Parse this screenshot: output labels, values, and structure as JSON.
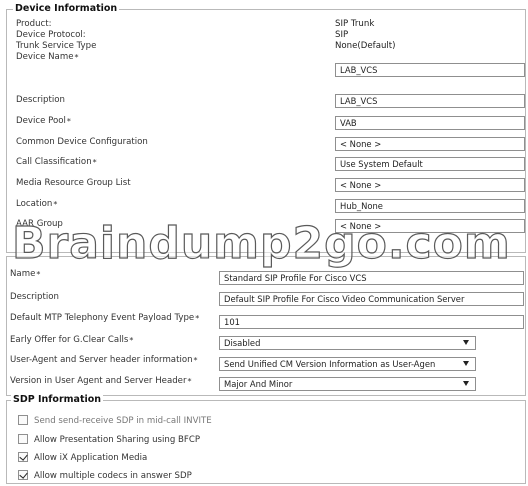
{
  "device_info": {
    "legend": "Device Information",
    "product_label": "Product:",
    "product_value": "SIP Trunk",
    "protocol_label": "Device Protocol:",
    "protocol_value": "SIP",
    "trunk_type_label": "Trunk Service Type",
    "trunk_type_value": "None(Default)",
    "device_name_label": "Device Name",
    "device_name_value": "LAB_VCS",
    "description_label": "Description",
    "description_value": "LAB_VCS",
    "device_pool_label": "Device Pool",
    "device_pool_value": "VAB",
    "common_config_label": "Common Device Configuration",
    "common_config_value": "< None >",
    "call_class_label": "Call Classification",
    "call_class_value": "Use System Default",
    "mrgl_label": "Media Resource Group List",
    "mrgl_value": "< None >",
    "location_label": "Location",
    "location_value": "Hub_None",
    "aar_label": "AAR Group",
    "aar_value": "< None >"
  },
  "sip_profile": {
    "name_label": "Name",
    "name_value": "Standard SIP Profile For Cisco VCS",
    "description_label": "Description",
    "description_value": "Default SIP Profile For Cisco Video Communication Server",
    "mtp_label": "Default MTP Telephony Event Payload Type",
    "mtp_value": "101",
    "early_offer_label": "Early Offer for G.Clear Calls",
    "early_offer_value": "Disabled",
    "useragent_label": "User-Agent and Server header information",
    "useragent_value": "Send Unified CM Version Information as User-Agen",
    "version_label": "Version in User Agent and Server Header",
    "version_value": "Major And Minor"
  },
  "sdp_info": {
    "legend": "SDP Information",
    "items": [
      {
        "label": "Send send-receive SDP in mid-call INVITE",
        "checked": false
      },
      {
        "label": "Allow Presentation Sharing using BFCP",
        "checked": false
      },
      {
        "label": "Allow iX Application Media",
        "checked": true
      },
      {
        "label": "Allow multiple codecs in answer SDP",
        "checked": true
      }
    ]
  },
  "watermark_text": "Braindump2go.com"
}
